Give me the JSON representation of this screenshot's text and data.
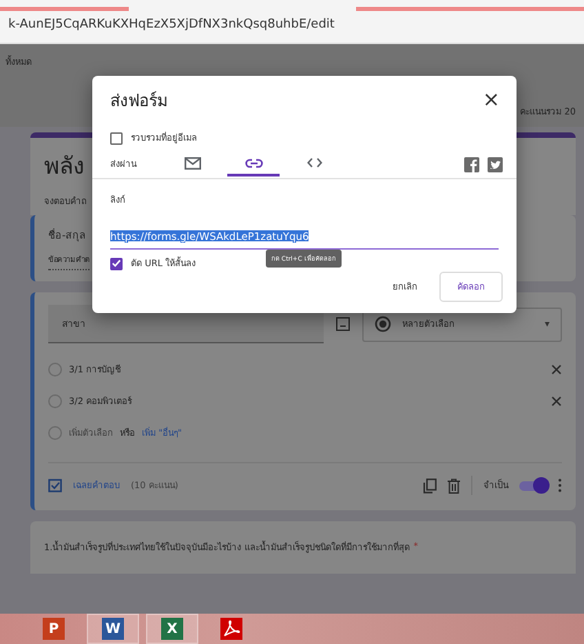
{
  "address_bar": {
    "url": "k-AunEJ5CqARKuKXHqEzX5XjDfNX3nkQsq8uhbE/edit"
  },
  "header": {
    "left_text": "ทั้งหมด",
    "total_points": "คะแนนรวม 20"
  },
  "form": {
    "title": "พลัง",
    "description": "จงตอบคำถ",
    "name_question": {
      "title": "ชื่อ-สกุล",
      "placeholder": "ข้อความคำต"
    },
    "edit_question": {
      "title": "สาขา",
      "type": "หลายตัวเลือก",
      "type_caret": "▾",
      "options": [
        {
          "label": "3/1 การบัญชี",
          "removable": true
        },
        {
          "label": "3/2 คอมพิวเตอร์",
          "removable": true
        }
      ],
      "add_option": "เพิ่มตัวเลือก",
      "or": "หรือ",
      "add_other": "เพิ่ม \"อื่นๆ\"",
      "answer_key": "เฉลยคำตอบ",
      "points": "(10 คะแนน)",
      "required_label": "จำเป็น",
      "required": true
    },
    "next_question": {
      "title": "1.น้ำมันสำเร็จรูปที่ประเทศไทยใช้ในปัจจุบันมีอะไรบ้าง และน้ำมันสำเร็จรูปชนิดใดที่มีการใช้มากที่สุด",
      "required_mark": "*"
    }
  },
  "dialog": {
    "title": "ส่งฟอร์ม",
    "close": "×",
    "collect_emails": {
      "label": "รวบรวมที่อยู่อีเมล",
      "checked": false
    },
    "send_via": "ส่งผ่าน",
    "tabs": [
      {
        "kind": "email",
        "selected": false
      },
      {
        "kind": "link",
        "selected": true
      },
      {
        "kind": "embed",
        "selected": false
      }
    ],
    "link_label": "ลิงก์",
    "link": "https://forms.gle/WSAkdLeP1zatuYqu6",
    "shorten_url": {
      "label": "ตัด URL ให้สั้นลง",
      "checked": true
    },
    "tooltip": "กด Ctrl+C เพื่อคัดลอก",
    "buttons": [
      "ยกเลิก",
      "คัดลอก"
    ]
  },
  "taskbar": [
    {
      "kind": "powerpoint",
      "letter": "P",
      "selected": false
    },
    {
      "kind": "word",
      "letter": "W",
      "selected": true
    },
    {
      "kind": "excel",
      "letter": "X",
      "selected": true
    },
    {
      "kind": "pdf",
      "selected": false
    }
  ]
}
